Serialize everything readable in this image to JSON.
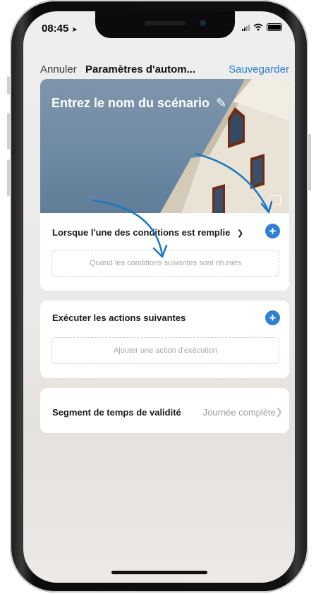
{
  "status_bar": {
    "time": "08:45"
  },
  "nav": {
    "cancel": "Annuler",
    "title": "Paramètres d'autom...",
    "save": "Sauvegarder"
  },
  "hero": {
    "title": "Entrez le nom du scénario",
    "edit_icon": "pencil-icon",
    "image_icon": "image-icon"
  },
  "conditions": {
    "title": "Lorsque l'une des conditions est remplie",
    "placeholder": "Quand les conditions suivantes sont réunies"
  },
  "actions": {
    "title": "Exécuter les actions suivantes",
    "placeholder": "Ajouter une action d'exécution"
  },
  "validity": {
    "label": "Segment de temps de validité",
    "value": "Journée complète"
  },
  "colors": {
    "accent": "#2f7fd2",
    "nav_link": "#2a7fd1",
    "arrow": "#1c78bf"
  }
}
